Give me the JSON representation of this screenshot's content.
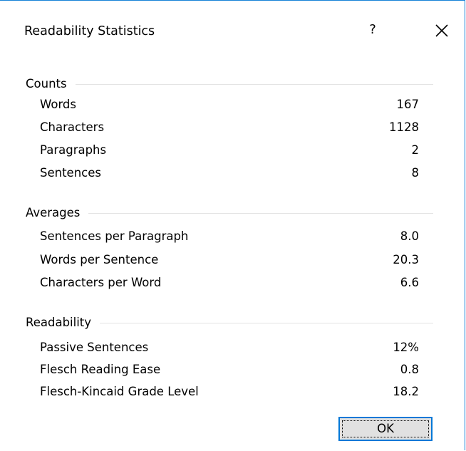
{
  "dialog": {
    "title": "Readability Statistics",
    "help_label": "?",
    "close_icon": "close-icon"
  },
  "counts": {
    "header": "Counts",
    "rows": [
      {
        "label": "Words",
        "value": "167"
      },
      {
        "label": "Characters",
        "value": "1128"
      },
      {
        "label": "Paragraphs",
        "value": "2"
      },
      {
        "label": "Sentences",
        "value": "8"
      }
    ]
  },
  "averages": {
    "header": "Averages",
    "rows": [
      {
        "label": "Sentences per Paragraph",
        "value": "8.0"
      },
      {
        "label": "Words per Sentence",
        "value": "20.3"
      },
      {
        "label": "Characters per Word",
        "value": "6.6"
      }
    ]
  },
  "readability": {
    "header": "Readability",
    "rows": [
      {
        "label": "Passive Sentences",
        "value": "12%"
      },
      {
        "label": "Flesch Reading Ease",
        "value": "0.8"
      },
      {
        "label": "Flesch-Kincaid Grade Level",
        "value": "18.2"
      }
    ]
  },
  "buttons": {
    "ok_label": "OK"
  },
  "colors": {
    "window_border": "#1883d7",
    "group_line": "#e3e3e3",
    "button_focus_border": "#0078d7",
    "button_face": "#e1e1e1"
  }
}
